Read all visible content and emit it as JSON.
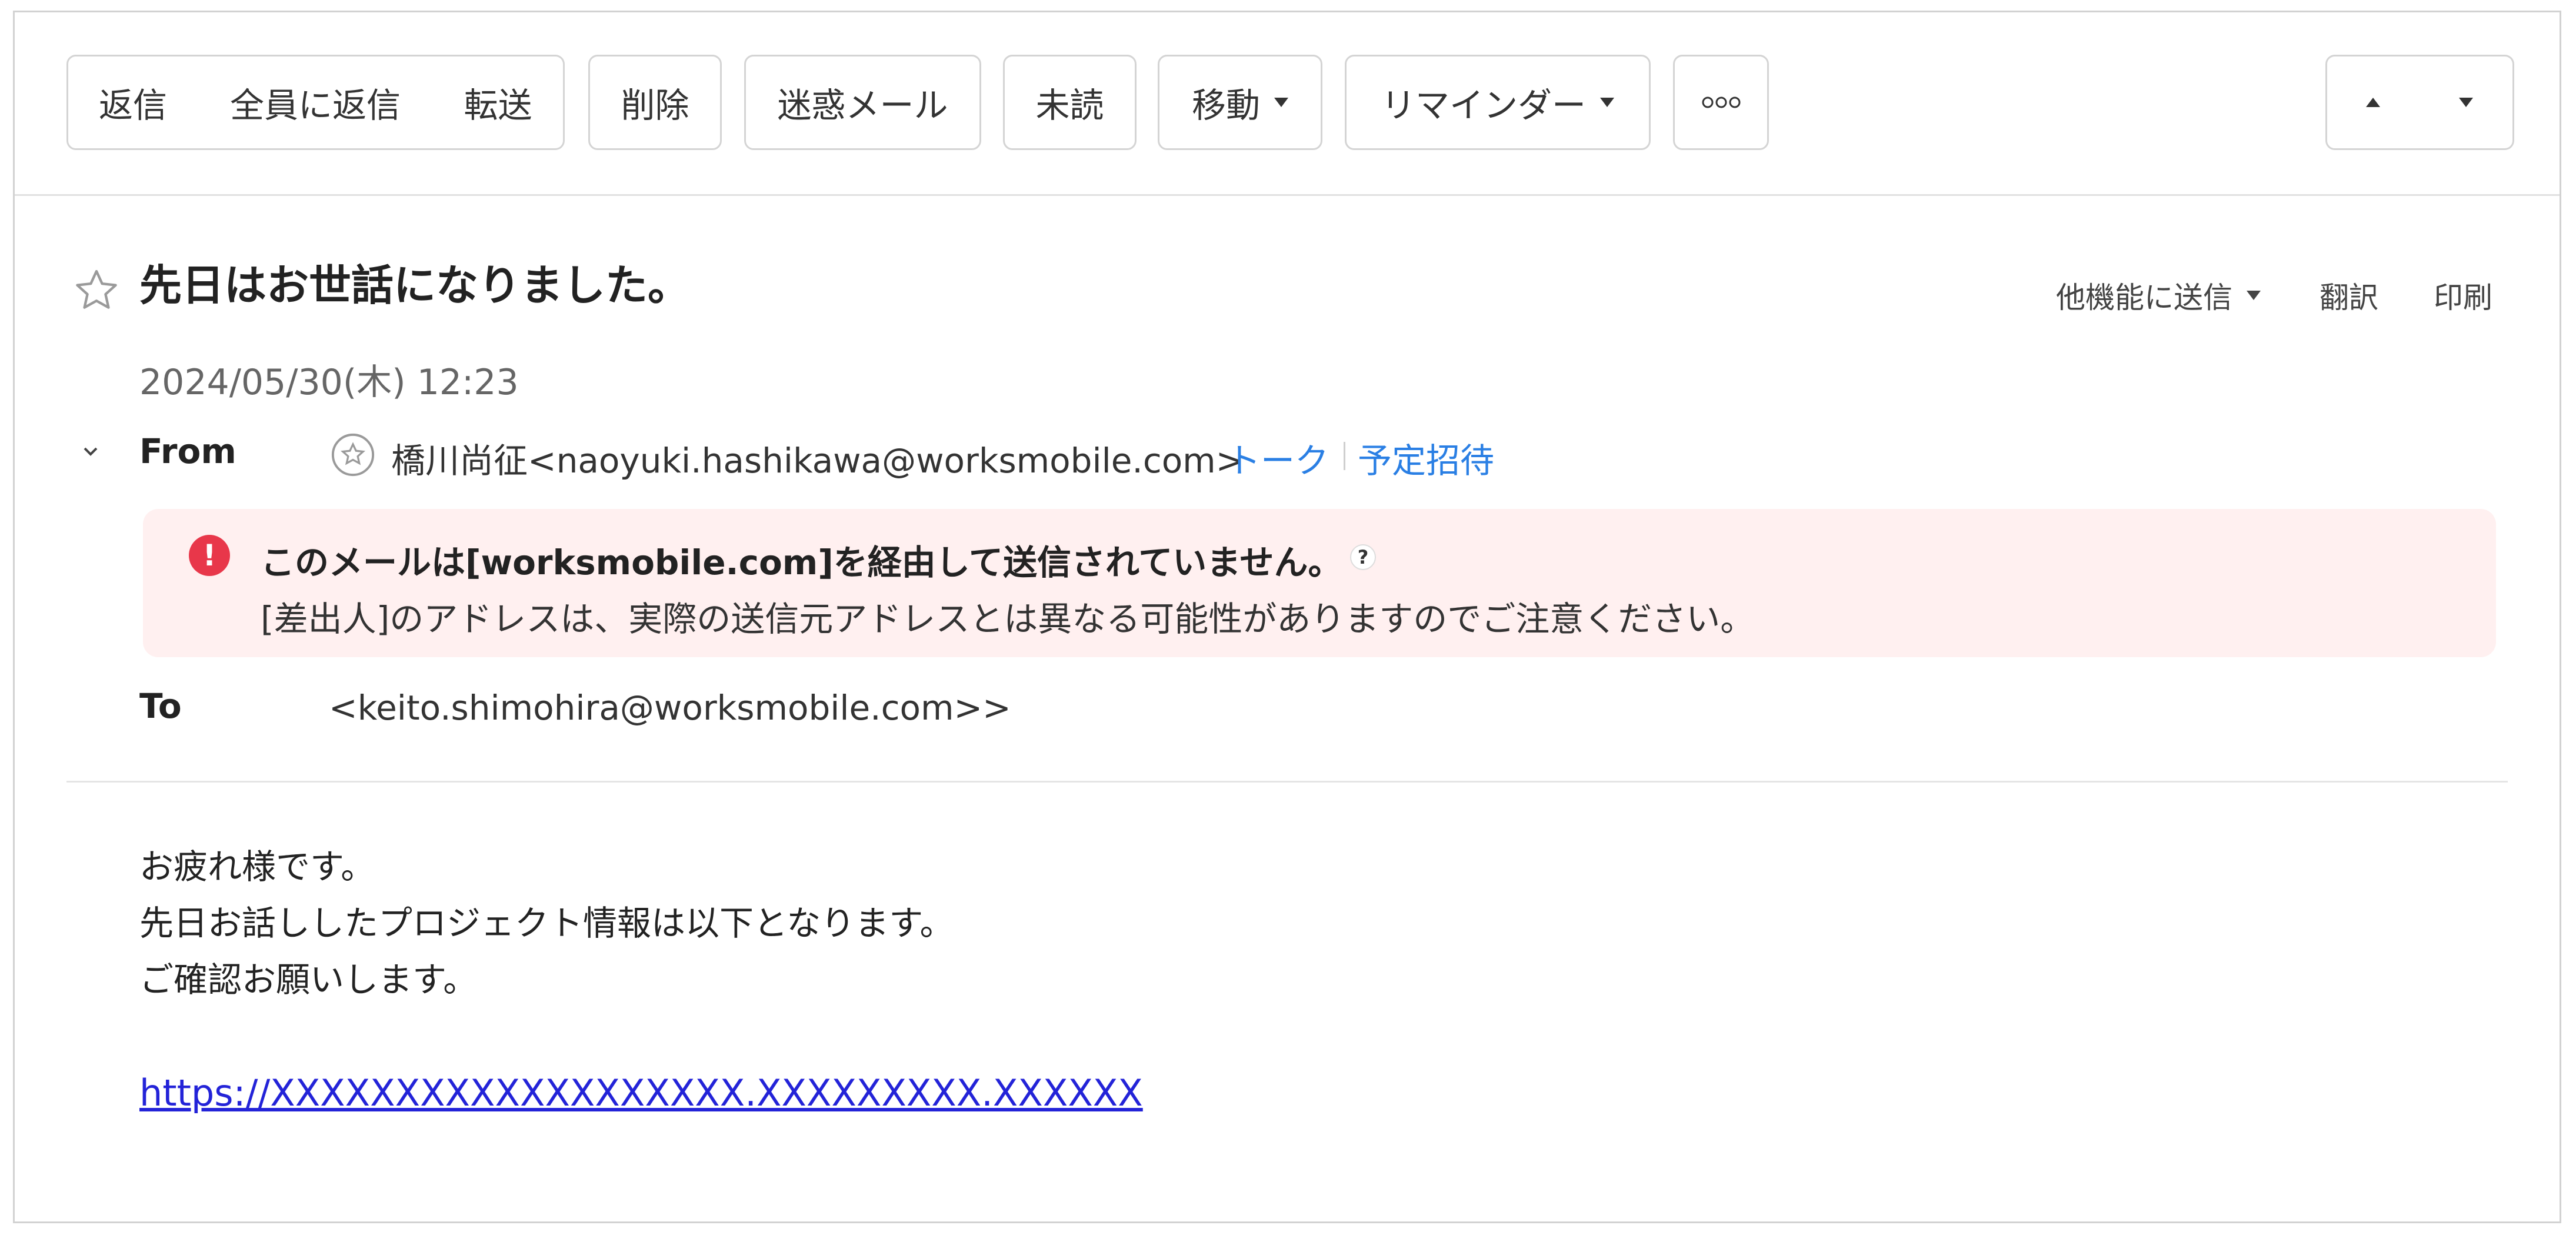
{
  "toolbar": {
    "reply": "返信",
    "reply_all": "全員に返信",
    "forward": "転送",
    "delete": "削除",
    "spam": "迷惑メール",
    "unread": "未読",
    "move": "移動",
    "reminder": "リマインダー",
    "more_icon": "more-dots-icon",
    "prev_icon": "caret-up-icon",
    "next_icon": "caret-down-icon"
  },
  "mail": {
    "subject": "先日はお世話になりました。",
    "date": "2024/05/30(木) 12:23",
    "actions": {
      "send_to_other": "他機能に送信",
      "translate": "翻訳",
      "print": "印刷"
    },
    "from": {
      "label": "From",
      "sender": "橋川尚征<naoyuki.hashikawa@worksmobile.com>",
      "talk": "トーク",
      "invite": "予定招待"
    },
    "warning": {
      "title": "このメールは[worksmobile.com]を経由して送信されていません。",
      "help": "?",
      "text": "[差出人]のアドレスは、実際の送信元アドレスとは異なる可能性がありますのでご注意ください。"
    },
    "to": {
      "label": "To",
      "recipient": "<keito.shimohira@worksmobile.com>>"
    },
    "body": {
      "lines": [
        "お疲れ様です。",
        "先日お話ししたプロジェクト情報は以下となります。",
        "ご確認お願いします。"
      ],
      "link": "https://XXXXXXXXXXXXXXXXXXX.XXXXXXXXX.XXXXXX"
    }
  },
  "colors": {
    "link": "#2a7fe4",
    "warning_bg": "#fff0f0",
    "warning_icon": "#e8374a",
    "body_link": "#2323d8"
  }
}
